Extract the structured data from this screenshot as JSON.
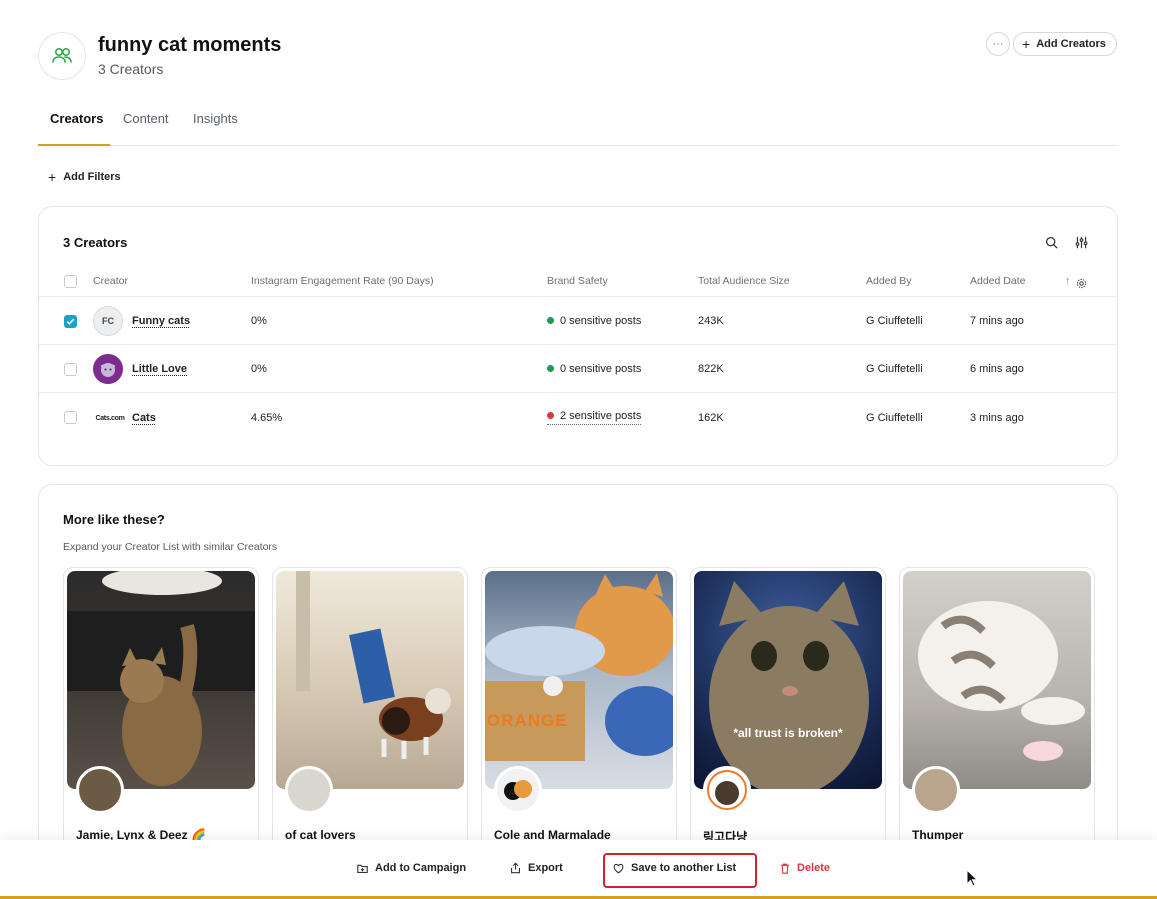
{
  "header": {
    "title": "funny cat moments",
    "subtitle": "3 Creators",
    "more_label": "···",
    "add_creators_label": "Add Creators"
  },
  "tabs": [
    {
      "label": "Creators",
      "active": true
    },
    {
      "label": "Content",
      "active": false
    },
    {
      "label": "Insights",
      "active": false
    }
  ],
  "filters": {
    "add_filters_label": "Add Filters"
  },
  "table": {
    "title": "3 Creators",
    "columns": [
      "Creator",
      "Instagram Engagement Rate (90 Days)",
      "Brand Safety",
      "Total Audience Size",
      "Added By",
      "Added Date"
    ],
    "sort_indicator": "↑",
    "rows": [
      {
        "initials": "FC",
        "name": "Funny cats",
        "engagement": "0%",
        "brand_safety": "0 sensitive posts",
        "safety_color": "#1a9e4a",
        "audience": "243K",
        "added_by": "G Ciuffetelli",
        "added_date": "7 mins ago",
        "checked": true
      },
      {
        "initials": "",
        "name": "Little Love",
        "engagement": "0%",
        "brand_safety": "0 sensitive posts",
        "safety_color": "#1a9e4a",
        "audience": "822K",
        "added_by": "G Ciuffetelli",
        "added_date": "6 mins ago",
        "checked": false
      },
      {
        "initials": "Cats.com",
        "name": "Cats",
        "engagement": "4.65%",
        "brand_safety": "2 sensitive posts",
        "safety_color": "#d63b3b",
        "audience": "162K",
        "added_by": "G Ciuffetelli",
        "added_date": "3 mins ago",
        "checked": false
      }
    ]
  },
  "suggestions": {
    "title": "More like these?",
    "subtitle": "Expand your Creator List with similar Creators",
    "items": [
      {
        "name": "Jamie, Lynx & Deez 🌈",
        "overlay": ""
      },
      {
        "name": "of cat lovers",
        "overlay": ""
      },
      {
        "name": "Cole and Marmalade",
        "overlay": "ORANGE"
      },
      {
        "name": "링고다냥",
        "overlay": "*all trust is broken*"
      },
      {
        "name": "Thumper",
        "overlay": ""
      }
    ]
  },
  "bottom_bar": {
    "add_to_campaign": "Add to Campaign",
    "export": "Export",
    "save_to_list": "Save to another List",
    "delete": "Delete"
  },
  "colors": {
    "accent": "#d4a017",
    "checkbox": "#1aa3c4",
    "danger": "#d61f26",
    "brand_green": "#2fa84f"
  }
}
